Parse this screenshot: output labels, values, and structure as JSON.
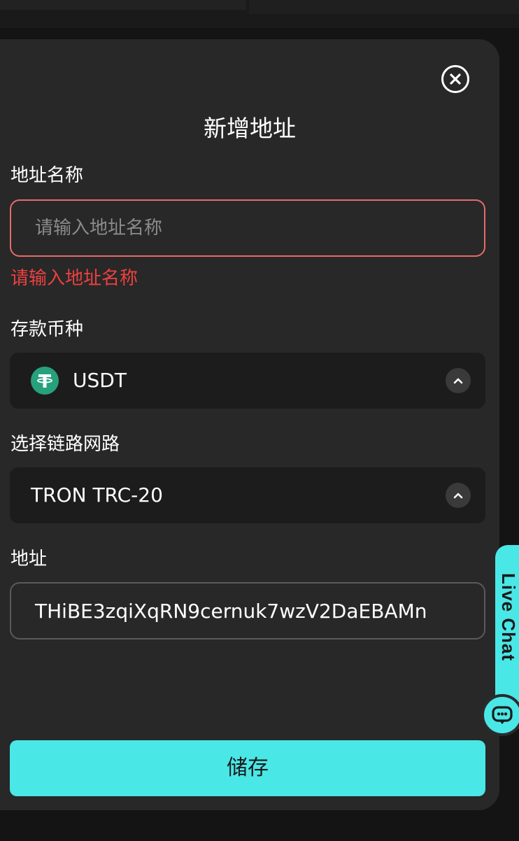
{
  "modal": {
    "title": "新增地址",
    "close_icon": "close-circle-icon"
  },
  "address_name": {
    "label": "地址名称",
    "placeholder": "请输入地址名称",
    "value": "",
    "error": "请输入地址名称"
  },
  "currency": {
    "label": "存款币种",
    "selected": "USDT",
    "icon": "usdt-tether-icon"
  },
  "network": {
    "label": "选择链路网路",
    "selected": "TRON TRC-20"
  },
  "address": {
    "label": "地址",
    "value": "THiBE3zqiXqRN9cernuk7wzV2DaEBAMn"
  },
  "save_button": "储存",
  "live_chat": {
    "label": "Live Chat",
    "icon": "chat-bubble-icon"
  },
  "colors": {
    "accent": "#4ae7e7",
    "error": "#ee4040",
    "modal_bg": "#282828",
    "usdt_green": "#26a17b"
  }
}
